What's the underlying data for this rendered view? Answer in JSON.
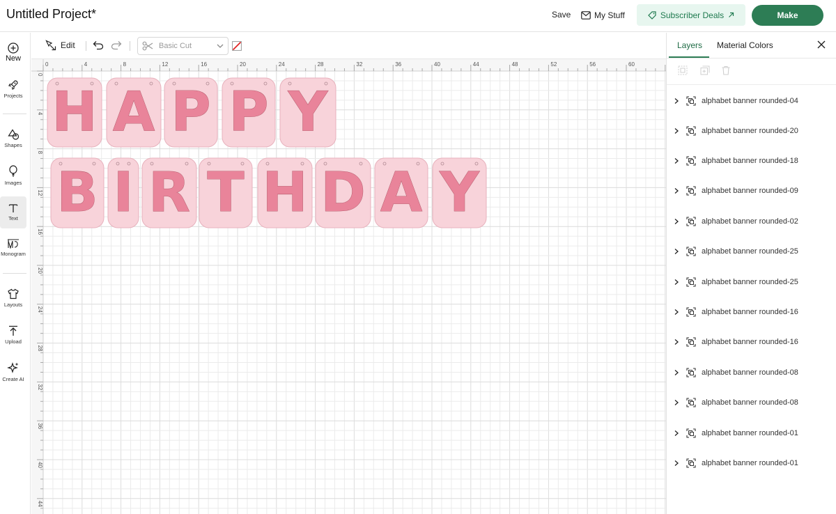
{
  "header": {
    "project_title": "Untitled Project*",
    "save_label": "Save",
    "mystuff_label": "My Stuff",
    "deals_label": "Subscriber Deals",
    "make_label": "Make"
  },
  "sidebar": {
    "items": [
      {
        "label": "New",
        "icon": "plus-circle-icon"
      },
      {
        "label": "Projects",
        "icon": "rocket-icon"
      },
      {
        "label": "Shapes",
        "icon": "shapes-icon"
      },
      {
        "label": "Images",
        "icon": "balloon-icon"
      },
      {
        "label": "Text",
        "icon": "text-icon"
      },
      {
        "label": "Monogram",
        "icon": "monogram-icon"
      },
      {
        "label": "Layouts",
        "icon": "shirt-icon"
      },
      {
        "label": "Upload",
        "icon": "upload-icon"
      },
      {
        "label": "Create AI",
        "icon": "sparkle-icon"
      }
    ]
  },
  "toolbar": {
    "edit_label": "Edit",
    "operation_value": "Basic Cut"
  },
  "canvas": {
    "ruler_top": [
      "0",
      "4",
      "8",
      "12",
      "16",
      "20",
      "24",
      "28",
      "32",
      "36",
      "40",
      "44",
      "48",
      "52",
      "56",
      "60"
    ],
    "ruler_left": [
      "0",
      "4",
      "8",
      "12",
      "16",
      "20",
      "24",
      "28",
      "32",
      "36",
      "40",
      "44"
    ],
    "line1": [
      "H",
      "A",
      "P",
      "P",
      "Y"
    ],
    "line2": [
      "B",
      "I",
      "R",
      "T",
      "H",
      "D",
      "A",
      "Y"
    ],
    "colors": {
      "letter_outer": "#f8d3da",
      "letter_inner": "#e9849a",
      "grid": "#ebebeb"
    }
  },
  "layers_panel": {
    "tabs": [
      "Layers",
      "Material Colors"
    ],
    "items": [
      "alphabet banner rounded-04",
      "alphabet banner rounded-20",
      "alphabet banner rounded-18",
      "alphabet banner rounded-09",
      "alphabet banner rounded-02",
      "alphabet banner rounded-25",
      "alphabet banner rounded-25",
      "alphabet banner rounded-16",
      "alphabet banner rounded-16",
      "alphabet banner rounded-08",
      "alphabet banner rounded-08",
      "alphabet banner rounded-01",
      "alphabet banner rounded-01"
    ]
  },
  "colors": {
    "accent": "#2d7d55",
    "deals_bg": "#e7f6ef"
  }
}
